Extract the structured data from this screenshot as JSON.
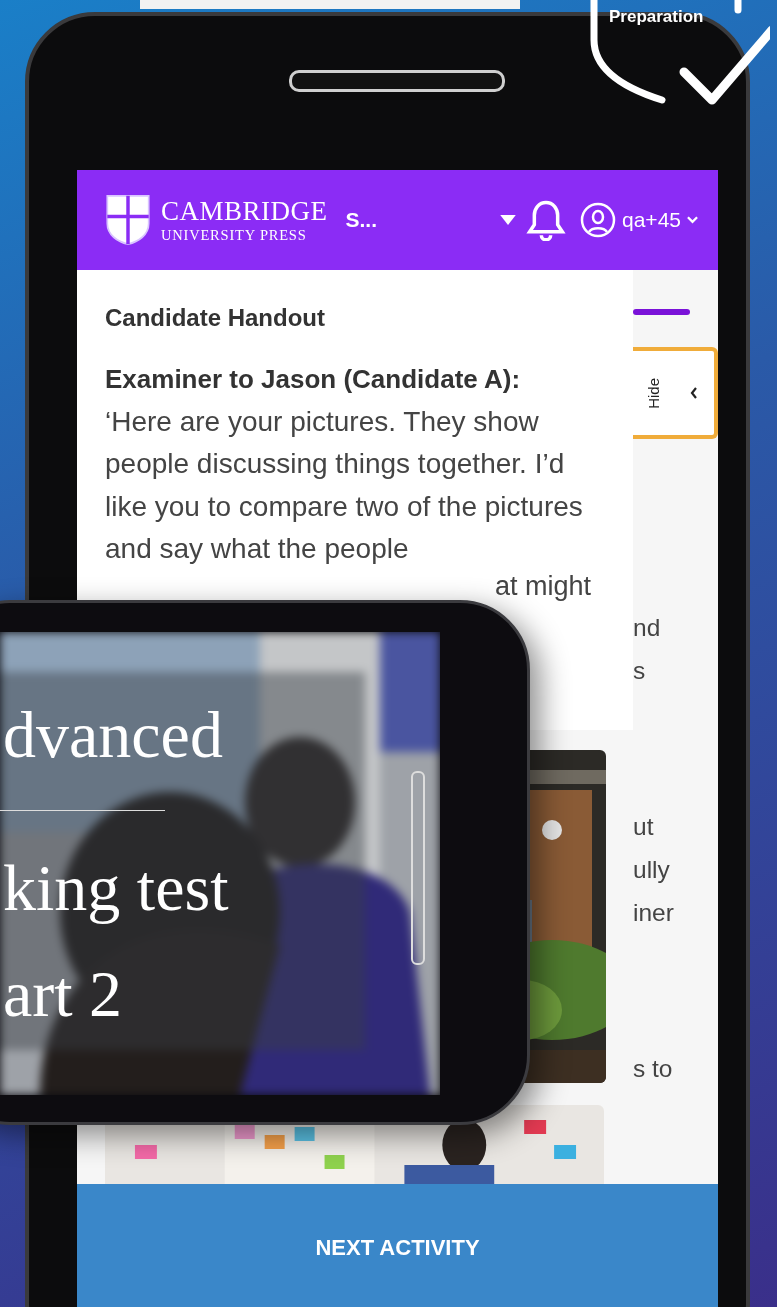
{
  "badge": {
    "text": "Preparation"
  },
  "header": {
    "brand_line_1": "CAMBRIDGE",
    "brand_line_2": "UNIVERSITY PRESS",
    "menu": "S...",
    "user": "qa+45"
  },
  "handout": {
    "title": "Candidate Handout",
    "speaker": "Examiner to Jason (Candidate A):",
    "text": "‘Here are your pictures. They show people discussing things together. I’d like you to compare two of the pictures and say what the people",
    "covered_line_end": "at might"
  },
  "side_panel": {
    "toggle": "Hide",
    "progress": {
      "level": 1
    }
  },
  "background_text": [
    "nd",
    "s",
    "ut",
    "ully",
    "iner",
    "s to"
  ],
  "video": {
    "lines": [
      "dvanced",
      "king test",
      "art 2"
    ]
  },
  "footer": {
    "button": "NEXT ACTIVITY"
  }
}
